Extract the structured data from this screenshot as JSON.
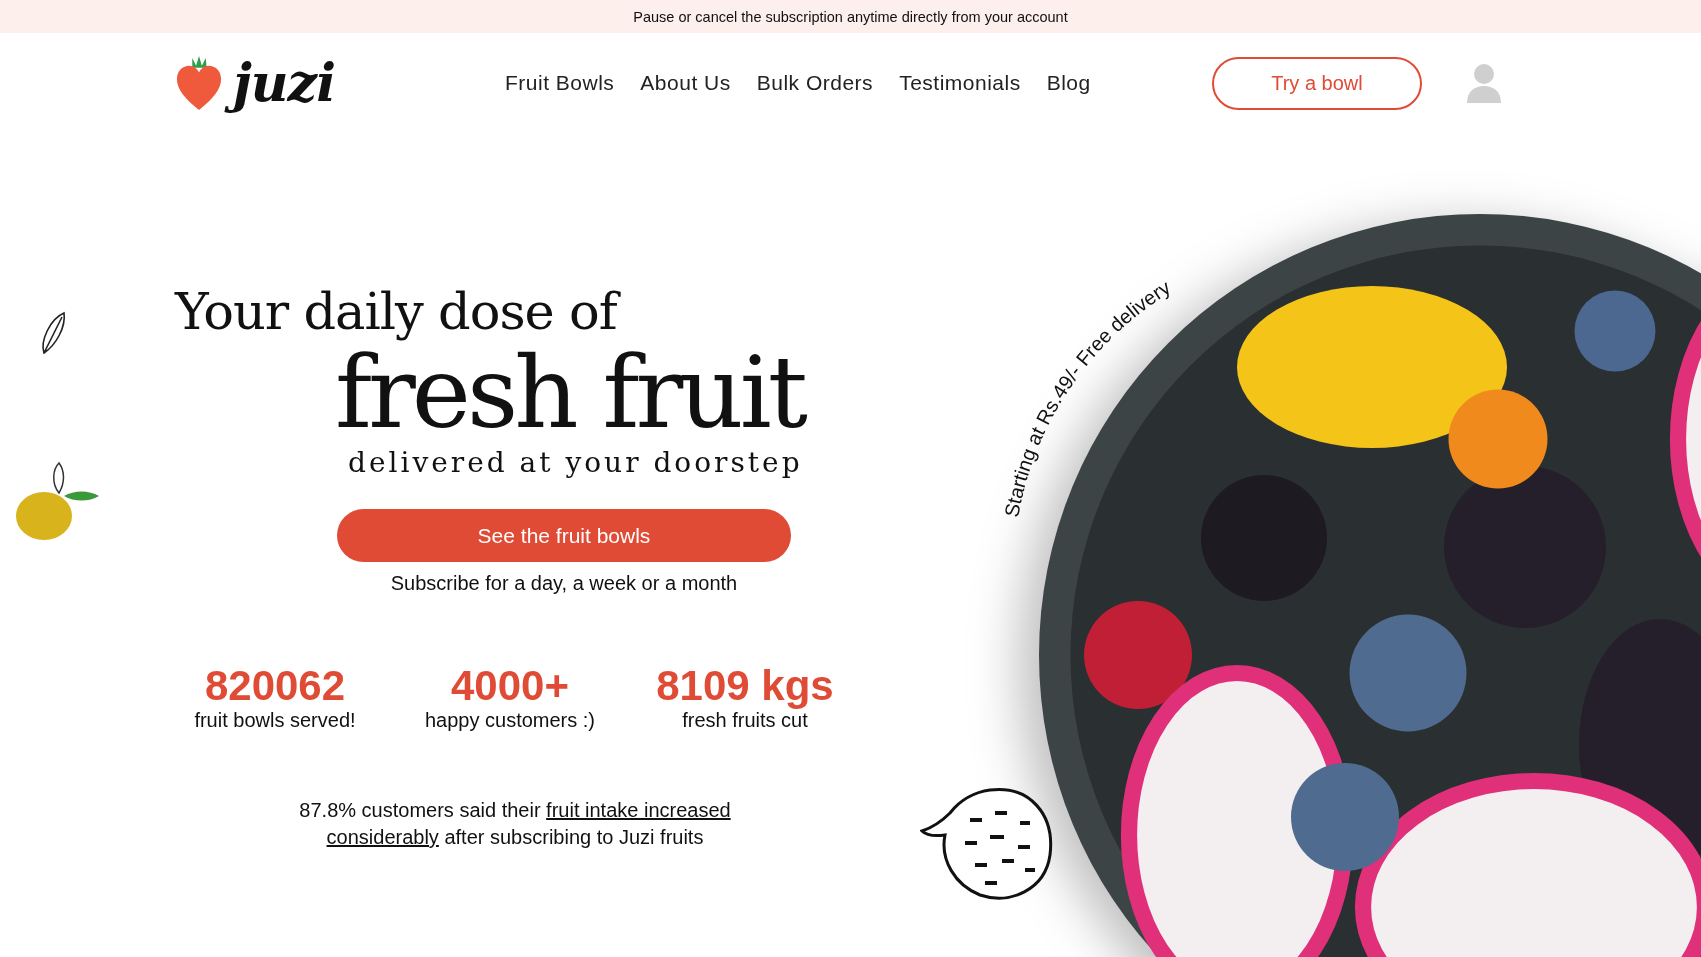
{
  "announcement": "Pause or cancel the subscription anytime directly from your account",
  "logo": {
    "text": "juzi"
  },
  "nav": [
    {
      "label": "Fruit Bowls"
    },
    {
      "label": "About Us"
    },
    {
      "label": "Bulk Orders"
    },
    {
      "label": "Testimonials"
    },
    {
      "label": "Blog"
    }
  ],
  "header_button": "Try a bowl",
  "hero": {
    "line_1": "Your daily dose of",
    "line_2": "fresh fruit",
    "line_3": "delivered at your doorstep",
    "cta": "See the fruit bowls",
    "subtext": "Subscribe for a day, a week or a month"
  },
  "stats": [
    {
      "value": "820062",
      "label": "fruit bowls served!"
    },
    {
      "value": "4000+",
      "label": "happy customers :)"
    },
    {
      "value": "8109 kgs",
      "label": "fresh fruits cut"
    }
  ],
  "note": {
    "lines": [
      [
        {
          "kind": "plain",
          "text": "87.8% customers said their "
        },
        {
          "kind": "link",
          "text": "fruit intake increased"
        }
      ],
      [
        {
          "kind": "link",
          "text": "considerably"
        },
        {
          "kind": "plain",
          "text": " after subscribing to Juzi fruits"
        }
      ]
    ]
  },
  "bowl_badge": "Starting at Rs.49/-  Free delivery"
}
